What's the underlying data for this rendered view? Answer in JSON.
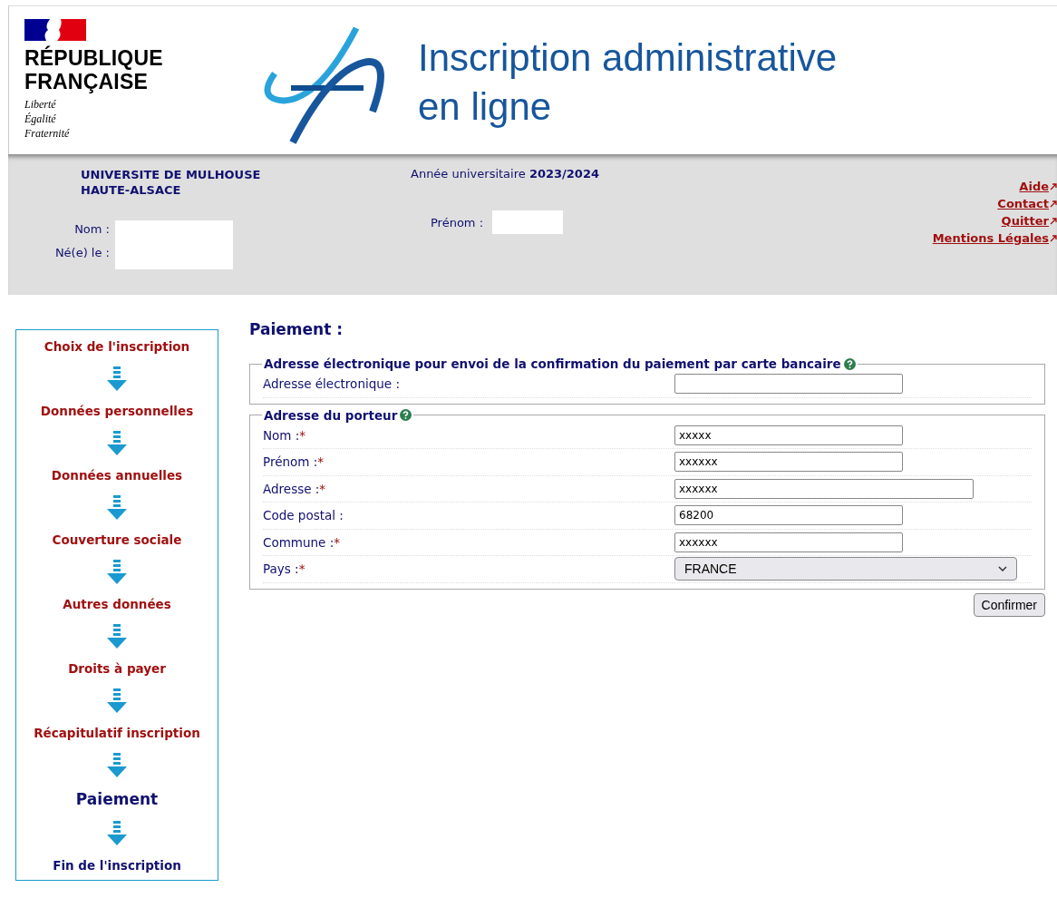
{
  "header": {
    "gov_logo": [
      "RÉPUBLIQUE",
      "FRANÇAISE"
    ],
    "motto": [
      "Liberté",
      "Égalité",
      "Fraternité"
    ],
    "title": [
      "Inscription administrative",
      "en ligne"
    ]
  },
  "info": {
    "university": [
      "UNIVERSITE DE MULHOUSE",
      "HAUTE-ALSACE"
    ],
    "year_label": "Année universitaire",
    "year": "2023/2024",
    "nom_label": "Nom :",
    "birth_label": "Né(e) le :",
    "prenom_label": "Prénom :"
  },
  "links": [
    "Aide",
    "Contact",
    "Quitter",
    "Mentions Légales"
  ],
  "steps": [
    {
      "label": "Choix de l'inscription",
      "done": true,
      "current": false
    },
    {
      "label": "Données personnelles",
      "done": true,
      "current": false
    },
    {
      "label": "Données annuelles",
      "done": true,
      "current": false
    },
    {
      "label": "Couverture sociale",
      "done": true,
      "current": false
    },
    {
      "label": "Autres données",
      "done": true,
      "current": false
    },
    {
      "label": "Droits à payer",
      "done": true,
      "current": false
    },
    {
      "label": "Récapitulatif inscription",
      "done": true,
      "current": false
    },
    {
      "label": "Paiement",
      "done": false,
      "current": true
    },
    {
      "label": "Fin de l'inscription",
      "done": false,
      "current": false
    }
  ],
  "page_title": "Paiement :",
  "sections": [
    {
      "legend": "Adresse électronique pour envoi de la confirmation du paiement par carte bancaire",
      "fields": [
        {
          "kind": "text",
          "label": "Adresse électronique :",
          "required": false
        }
      ]
    },
    {
      "legend": "Adresse du porteur",
      "fields": [
        {
          "kind": "text",
          "label": "Nom :",
          "required": true,
          "value": "xxxxx"
        },
        {
          "kind": "text",
          "label": "Prénom :",
          "required": true,
          "value": "xxxxxx"
        },
        {
          "kind": "long_text",
          "label": "Adresse :",
          "required": true,
          "value": "xxxxxx"
        },
        {
          "kind": "text",
          "label": "Code postal :",
          "required": false,
          "value": "68200"
        },
        {
          "kind": "text",
          "label": "Commune :",
          "required": true,
          "value": "xxxxxx"
        },
        {
          "kind": "select",
          "label": "Pays :",
          "required": true,
          "value": "FRANCE"
        }
      ]
    }
  ],
  "required_mark": "*",
  "confirm_button": "Confirmer"
}
